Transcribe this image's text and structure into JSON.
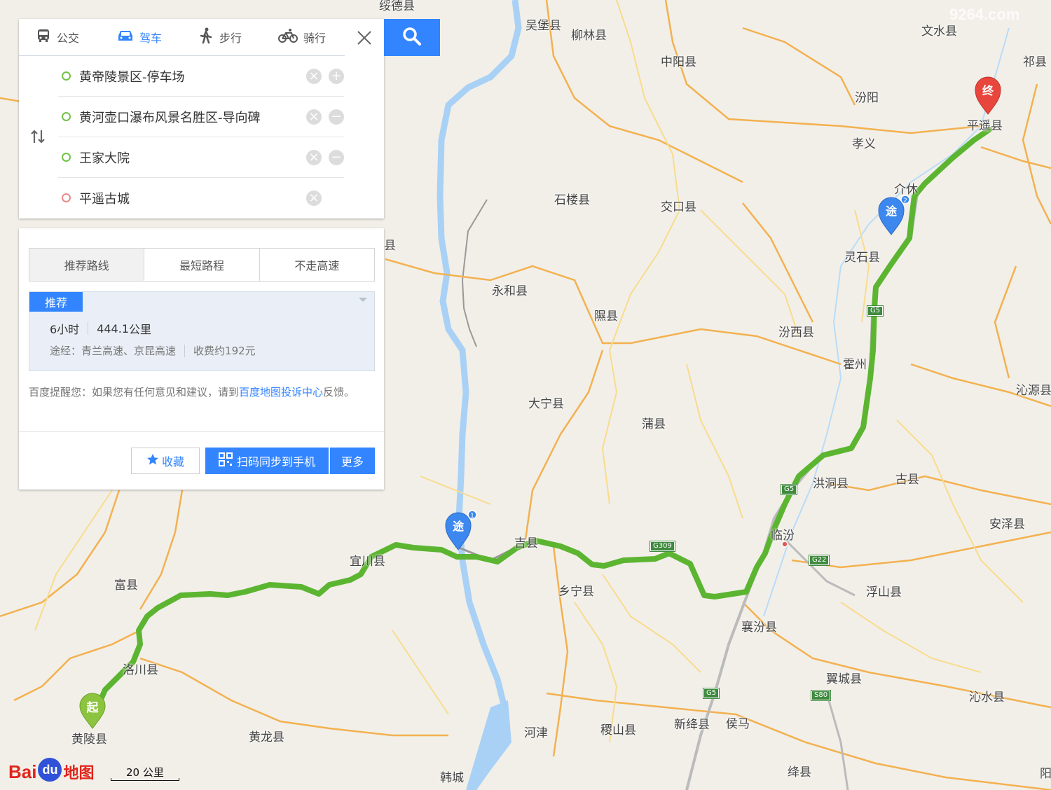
{
  "tabs": [
    {
      "label": "公交",
      "icon": "bus-icon"
    },
    {
      "label": "驾车",
      "icon": "car-icon"
    },
    {
      "label": "步行",
      "icon": "walk-icon"
    },
    {
      "label": "骑行",
      "icon": "bike-icon"
    }
  ],
  "active_tab": "驾车",
  "stops": [
    {
      "label": "黄帝陵景区-停车场",
      "action": "add"
    },
    {
      "label": "黄河壶口瀑布风景名胜区-导向碑",
      "action": "remove"
    },
    {
      "label": "王家大院",
      "action": "remove"
    },
    {
      "label": "平遥古城",
      "action": "none"
    }
  ],
  "route_tabs": [
    "推荐路线",
    "最短路程",
    "不走高速"
  ],
  "recommended": {
    "badge": "推荐",
    "time": "6小时",
    "distance": "444.1",
    "distance_unit": "公里",
    "via_label": "途经：",
    "via": "青兰高速、京昆高速",
    "toll": "收费约192元"
  },
  "notice": {
    "prefix": "百度提醒您：如果您有任何意见和建议，请到",
    "link": "百度地图投诉中心",
    "suffix": "反馈。"
  },
  "buttons": {
    "favorite": "收藏",
    "sync": "扫码同步到手机",
    "more": "更多"
  },
  "markers": {
    "start": "起",
    "waypoint": "途",
    "end": "终",
    "wp1": "1",
    "wp2": "2"
  },
  "scale": "20 公里",
  "logo": {
    "bai": "Bai",
    "du": "du",
    "map": "地图"
  },
  "watermark": "9264.com",
  "places": [
    "绥德县",
    "吴堡县",
    "柳林县",
    "中阳县",
    "文水县",
    "祁县",
    "汾阳",
    "孝义",
    "平遥县",
    "介休",
    "石楼县",
    "交口县",
    "灵石县",
    "永和县",
    "隰县",
    "汾西县",
    "霍州",
    "沁源县",
    "大宁县",
    "蒲县",
    "洪洞县",
    "古县",
    "临汾",
    "安泽县",
    "吉县",
    "乡宁县",
    "宜川县",
    "富县",
    "襄汾县",
    "浮山县",
    "洛川县",
    "翼城县",
    "沁水县",
    "黄陵县",
    "黄龙县",
    "河津",
    "稷山县",
    "新绛县",
    "侯马",
    "韩城",
    "绛县",
    "阳",
    "县"
  ],
  "road_shields": [
    "G5",
    "G5",
    "G5",
    "G309",
    "G22",
    "G5",
    "S80"
  ],
  "colors": {
    "accent": "#3385ff",
    "route": "#5cb531",
    "start_marker": "#8cc43f",
    "end_marker": "#e8463c"
  }
}
